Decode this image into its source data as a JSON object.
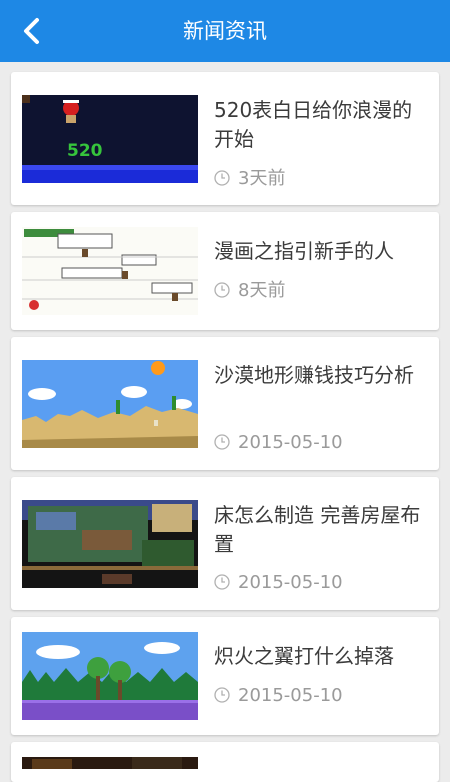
{
  "header": {
    "title": "新闻资讯",
    "back_icon": "chevron-left-icon"
  },
  "colors": {
    "header": "#1e88e5",
    "background": "#ececec",
    "card": "#ffffff",
    "headline": "#3b3b3b",
    "meta": "#9a9a9a"
  },
  "news": [
    {
      "title": "520表白日给你浪漫的开始",
      "time": "3天前",
      "thumb": "night-scene-thumbnail"
    },
    {
      "title": "漫画之指引新手的人",
      "time": "8天前",
      "thumb": "comic-strip-thumbnail"
    },
    {
      "title": "沙漠地形赚钱技巧分析",
      "time": "2015-05-10",
      "thumb": "desert-terrain-thumbnail"
    },
    {
      "title": "床怎么制造 完善房屋布置",
      "time": "2015-05-10",
      "thumb": "house-interior-thumbnail"
    },
    {
      "title": "炽火之翼打什么掉落",
      "time": "2015-05-10",
      "thumb": "forest-scene-thumbnail"
    },
    {
      "title": "",
      "time": "",
      "thumb": "partial-thumbnail"
    }
  ]
}
